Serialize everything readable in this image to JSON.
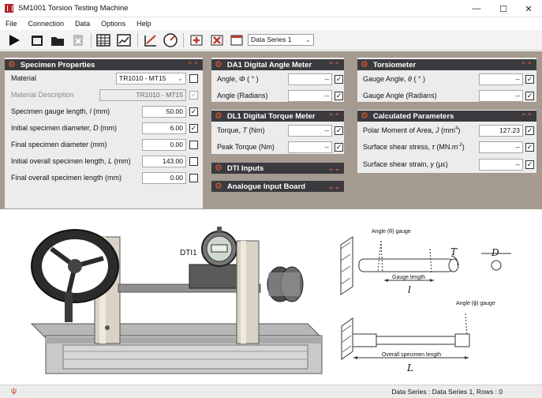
{
  "window": {
    "title": "SM1001 Torsion Testing Machine"
  },
  "menu": [
    "File",
    "Connection",
    "Data",
    "Options",
    "Help"
  ],
  "toolbar": {
    "series_select": "Data Series 1",
    "icons": [
      "play-icon",
      "new-table-icon",
      "open-folder-icon",
      "delete-file-icon",
      "table-view-icon",
      "chart-view-icon",
      "graph-edit-icon",
      "gauge-icon",
      "add-row-icon",
      "delete-row-icon",
      "table-settings-icon"
    ]
  },
  "specimen": {
    "title": "Specimen Properties",
    "material_label": "Material",
    "material_value": "TR1010 - MT15",
    "description_label": "Material Description",
    "description_value": "TR1010 - MT15",
    "gauge_length_label": "Specimen gauge length, ",
    "gauge_length_symbol": "l",
    "gauge_length_unit": " (mm)",
    "gauge_length_value": "50.00",
    "init_diameter_label": "Initial specimen diameter, ",
    "init_diameter_symbol": "D",
    "init_diameter_unit": " (mm)",
    "init_diameter_value": "6.00",
    "final_diameter_label": "Final specimen diameter (mm)",
    "final_diameter_value": "0.00",
    "init_length_label": "Initial overall specimen length, ",
    "init_length_symbol": "L",
    "init_length_unit": " (mm)",
    "init_length_value": "143.00",
    "final_length_label": "Final overall specimen length (mm)",
    "final_length_value": "0.00"
  },
  "angle_meter": {
    "title": "DA1 Digital Angle Meter",
    "angle_label": "Angle, ",
    "angle_symbol": "Φ",
    "angle_unit": " ( ° )",
    "angle_value": "--",
    "radians_label": "Angle  (Radians)",
    "radians_value": "--"
  },
  "torque_meter": {
    "title": "DL1 Digital Torque Meter",
    "torque_label": "Torque, ",
    "torque_symbol": "T",
    "torque_unit": " (Nm)",
    "torque_value": "--",
    "peak_label": "Peak Torque  (Nm)",
    "peak_value": "--"
  },
  "dti": {
    "title": "DTI Inputs"
  },
  "analogue": {
    "title": "Analogue Input Board"
  },
  "torsiometer": {
    "title": "Torsiometer",
    "gauge_angle_label": "Gauge Angle, ",
    "gauge_angle_symbol": "θ",
    "gauge_angle_unit": " ( ° )",
    "gauge_angle_value": "--",
    "gauge_rad_label": "Gauge Angle  (Radians)",
    "gauge_rad_value": "--"
  },
  "calculated": {
    "title": "Calculated Parameters",
    "polar_label": "Polar Moment of Area, ",
    "polar_symbol": "J",
    "polar_unit": " (mm",
    "polar_exp": "4",
    "polar_close": ")",
    "polar_value": "127.23",
    "stress_label": "Surface shear stress, ",
    "stress_symbol": "τ",
    "stress_unit": " (MN.m",
    "stress_exp": "-2",
    "stress_close": ")",
    "stress_value": "--",
    "strain_label": "Surface shear strain, ",
    "strain_symbol": "γ",
    "strain_unit": " (με)",
    "strain_value": "--"
  },
  "diagram": {
    "dti_label": "DTI1",
    "angle_theta_gauge": "Angle (θ) gauge",
    "torque_symbol": "T",
    "diameter_symbol": "D",
    "gauge_length": "Gauge length",
    "gauge_symbol": "l",
    "angle_phi_gauge": "Angle (ϕ) gauge",
    "overall_length": "Overall specimen length",
    "overall_symbol": "L"
  },
  "status": {
    "text": "Data Series : Data Series 1,  Rows : 0"
  },
  "colors": {
    "panel_head": "#3b3b3f",
    "accent": "#e85c2c",
    "panel_bg": "#ececec",
    "frame": "#a49a90"
  }
}
